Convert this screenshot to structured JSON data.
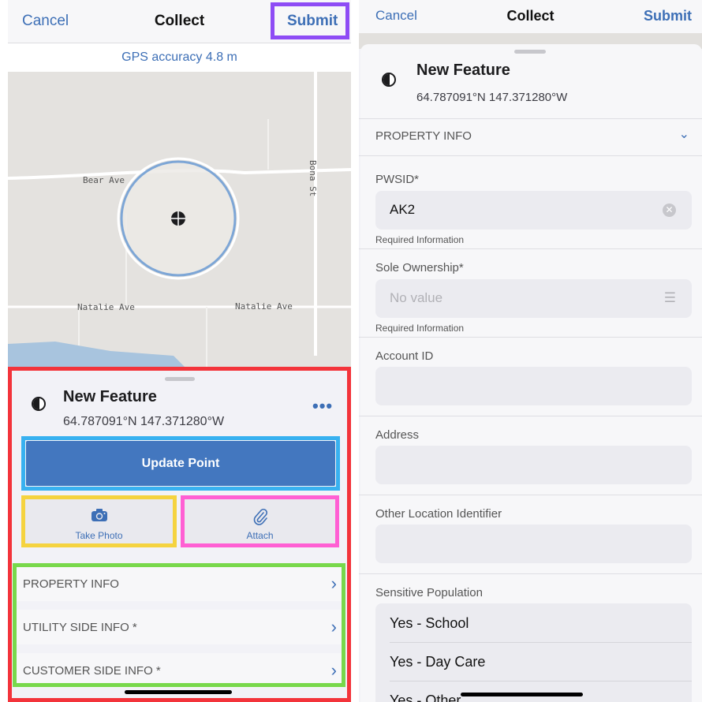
{
  "left_panel": {
    "nav": {
      "cancel": "Cancel",
      "title": "Collect",
      "submit": "Submit"
    },
    "gps_status": "GPS accuracy 4.8 m",
    "map": {
      "streets": [
        "Bear Ave",
        "Bona St",
        "Natalie Ave",
        "Natalie Ave"
      ]
    },
    "feature": {
      "title": "New Feature",
      "coords": "64.787091°N  147.371280°W",
      "more": "•••"
    },
    "update_button": "Update Point",
    "take_photo": "Take Photo",
    "attach": "Attach",
    "sections": [
      {
        "label": "PROPERTY INFO"
      },
      {
        "label": "UTILITY SIDE INFO *"
      },
      {
        "label": "CUSTOMER SIDE INFO *"
      }
    ],
    "highlight_colors": {
      "submit": "#8e4cf5",
      "sheet": "#f3343b",
      "update": "#38b1f0",
      "photo": "#f5d33f",
      "attach": "#ff5fd3",
      "sections": "#78d84b"
    }
  },
  "right_panel": {
    "nav": {
      "cancel": "Cancel",
      "title": "Collect",
      "submit": "Submit"
    },
    "feature": {
      "title": "New Feature",
      "coords": "64.787091°N  147.371280°W"
    },
    "section_header": "PROPERTY INFO",
    "fields": {
      "pwsid": {
        "label": "PWSID*",
        "value": "AK2",
        "hint": "Required Information"
      },
      "sole_ownership": {
        "label": "Sole Ownership*",
        "placeholder": "No value",
        "hint": "Required Information"
      },
      "account_id": {
        "label": "Account ID",
        "value": ""
      },
      "address": {
        "label": "Address",
        "value": ""
      },
      "other_location": {
        "label": "Other Location Identifier",
        "value": ""
      },
      "sensitive_population": {
        "label": "Sensitive Population",
        "options": [
          "Yes - School",
          "Yes - Day Care",
          "Yes - Other"
        ]
      }
    }
  },
  "accent_color": "#3d6fb6"
}
